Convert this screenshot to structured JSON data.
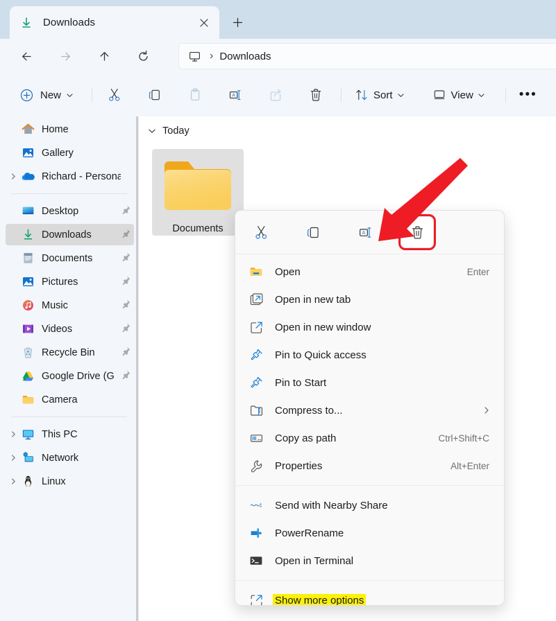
{
  "window": {
    "tab": {
      "title": "Downloads",
      "icon": "downloads-arrow-icon",
      "close": "✕",
      "new_tab": "+"
    },
    "accent_red": "#ee1c25",
    "highlight_yellow": "#fbf10a"
  },
  "nav": {
    "back": "←",
    "forward": "→",
    "up": "↑",
    "refresh": "↻",
    "breadcrumb": {
      "root_icon": "this-pc-icon",
      "separator": "›",
      "current": "Downloads"
    }
  },
  "toolbar": {
    "new_label": "New",
    "new_chevron": "∨",
    "cut_label": "Cut",
    "copy_label": "Copy",
    "paste_label": "Paste",
    "rename_label": "Rename",
    "share_label": "Share",
    "delete_label": "Delete",
    "sort_label": "Sort",
    "sort_chevron": "∨",
    "view_label": "View",
    "view_chevron": "∨",
    "more_label": "•••"
  },
  "sidebar": {
    "items": [
      {
        "label": "Home",
        "icon": "home-icon",
        "chevron": false,
        "pinned": false,
        "selected": false
      },
      {
        "label": "Gallery",
        "icon": "gallery-icon",
        "chevron": false,
        "pinned": false,
        "selected": false
      },
      {
        "label": "Richard - Personal",
        "icon": "onedrive-icon",
        "chevron": true,
        "pinned": false,
        "selected": false
      },
      {
        "divider": true
      },
      {
        "label": "Desktop",
        "icon": "desktop-icon",
        "chevron": false,
        "pinned": true,
        "selected": false
      },
      {
        "label": "Downloads",
        "icon": "downloads-icon",
        "chevron": false,
        "pinned": true,
        "selected": true
      },
      {
        "label": "Documents",
        "icon": "documents-icon",
        "chevron": false,
        "pinned": true,
        "selected": false
      },
      {
        "label": "Pictures",
        "icon": "pictures-icon",
        "chevron": false,
        "pinned": true,
        "selected": false
      },
      {
        "label": "Music",
        "icon": "music-icon",
        "chevron": false,
        "pinned": true,
        "selected": false
      },
      {
        "label": "Videos",
        "icon": "videos-icon",
        "chevron": false,
        "pinned": true,
        "selected": false
      },
      {
        "label": "Recycle Bin",
        "icon": "recycle-bin-icon",
        "chevron": false,
        "pinned": true,
        "selected": false
      },
      {
        "label": "Google Drive (G",
        "icon": "google-drive-icon",
        "chevron": false,
        "pinned": true,
        "selected": false
      },
      {
        "label": "Camera",
        "icon": "folder-icon",
        "chevron": false,
        "pinned": false,
        "selected": false
      },
      {
        "divider": true
      },
      {
        "label": "This PC",
        "icon": "this-pc-icon",
        "chevron": true,
        "pinned": false,
        "selected": false
      },
      {
        "label": "Network",
        "icon": "network-icon",
        "chevron": true,
        "pinned": false,
        "selected": false
      },
      {
        "label": "Linux",
        "icon": "linux-penguin-icon",
        "chevron": true,
        "pinned": false,
        "selected": false
      }
    ],
    "chevron_glyph": "›"
  },
  "files": {
    "group_header": "Today",
    "group_chevron": "∨",
    "items": [
      {
        "name": "Documents",
        "icon": "folder-icon",
        "selected": true
      }
    ]
  },
  "context_menu": {
    "toolbar_buttons": [
      {
        "name": "cut",
        "icon": "scissors-icon",
        "highlighted": false
      },
      {
        "name": "copy",
        "icon": "copy-icon",
        "highlighted": false
      },
      {
        "name": "rename",
        "icon": "rename-icon",
        "highlighted": false
      },
      {
        "name": "delete",
        "icon": "trash-icon",
        "highlighted": true
      }
    ],
    "groups": [
      {
        "items": [
          {
            "label": "Open",
            "icon": "folder-icon",
            "accel": "Enter",
            "submenu": false,
            "highlight": false
          },
          {
            "label": "Open in new tab",
            "icon": "new-tab-icon",
            "accel": "",
            "submenu": false,
            "highlight": false
          },
          {
            "label": "Open in new window",
            "icon": "new-window-icon",
            "accel": "",
            "submenu": false,
            "highlight": false
          },
          {
            "label": "Pin to Quick access",
            "icon": "pin-icon",
            "accel": "",
            "submenu": false,
            "highlight": false
          },
          {
            "label": "Pin to Start",
            "icon": "pin-icon",
            "accel": "",
            "submenu": false,
            "highlight": false
          },
          {
            "label": "Compress to...",
            "icon": "compress-icon",
            "accel": "",
            "submenu": true,
            "highlight": false
          },
          {
            "label": "Copy as path",
            "icon": "copy-path-icon",
            "accel": "Ctrl+Shift+C",
            "submenu": false,
            "highlight": false
          },
          {
            "label": "Properties",
            "icon": "wrench-icon",
            "accel": "Alt+Enter",
            "submenu": false,
            "highlight": false
          }
        ]
      },
      {
        "items": [
          {
            "label": "Send with Nearby Share",
            "icon": "nearby-share-icon",
            "accel": "",
            "submenu": false,
            "highlight": false
          },
          {
            "label": "PowerRename",
            "icon": "powerrename-icon",
            "accel": "",
            "submenu": false,
            "highlight": false
          },
          {
            "label": "Open in Terminal",
            "icon": "terminal-icon",
            "accel": "",
            "submenu": false,
            "highlight": false
          }
        ]
      },
      {
        "items": [
          {
            "label": "Show more options",
            "icon": "show-more-icon",
            "accel": "",
            "submenu": false,
            "highlight": true
          }
        ]
      }
    ],
    "submenu_glyph": "›"
  },
  "annotations": {
    "arrow_color": "#ee1c25",
    "arrow_target": "delete-button-in-context-menu-toolbar",
    "highlight_box_target": "delete-button-in-context-menu-toolbar"
  }
}
